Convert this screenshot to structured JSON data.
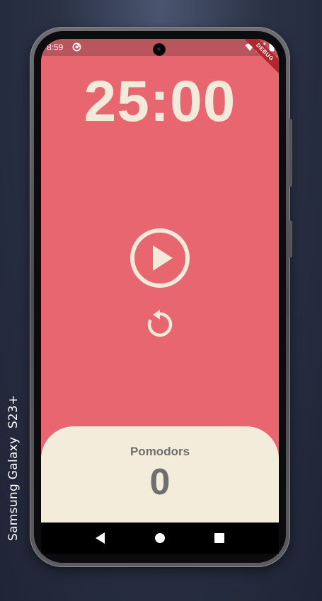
{
  "device": {
    "label": "Samsung Galaxy  S23+"
  },
  "status_bar": {
    "time": "8:59",
    "icons": [
      "app-notification-icon",
      "wifi-icon",
      "signal-icon",
      "battery-icon"
    ]
  },
  "debug_banner": {
    "text": "DEBUG"
  },
  "timer": {
    "display": "25:00"
  },
  "controls": {
    "play_icon": "play-circle-icon",
    "reset_icon": "reset-icon"
  },
  "pomodoro": {
    "label": "Pomodors",
    "count": "0"
  },
  "nav_bar": {
    "buttons": [
      "back-icon",
      "home-icon",
      "recents-icon"
    ]
  },
  "colors": {
    "screen_background": "#E8666F",
    "status_bar": "#B9555D",
    "accent_cream": "#F3EAD9",
    "panel_background": "#F3ECDB",
    "panel_text": "#6E6E6E",
    "debug_banner": "#B3262F"
  }
}
